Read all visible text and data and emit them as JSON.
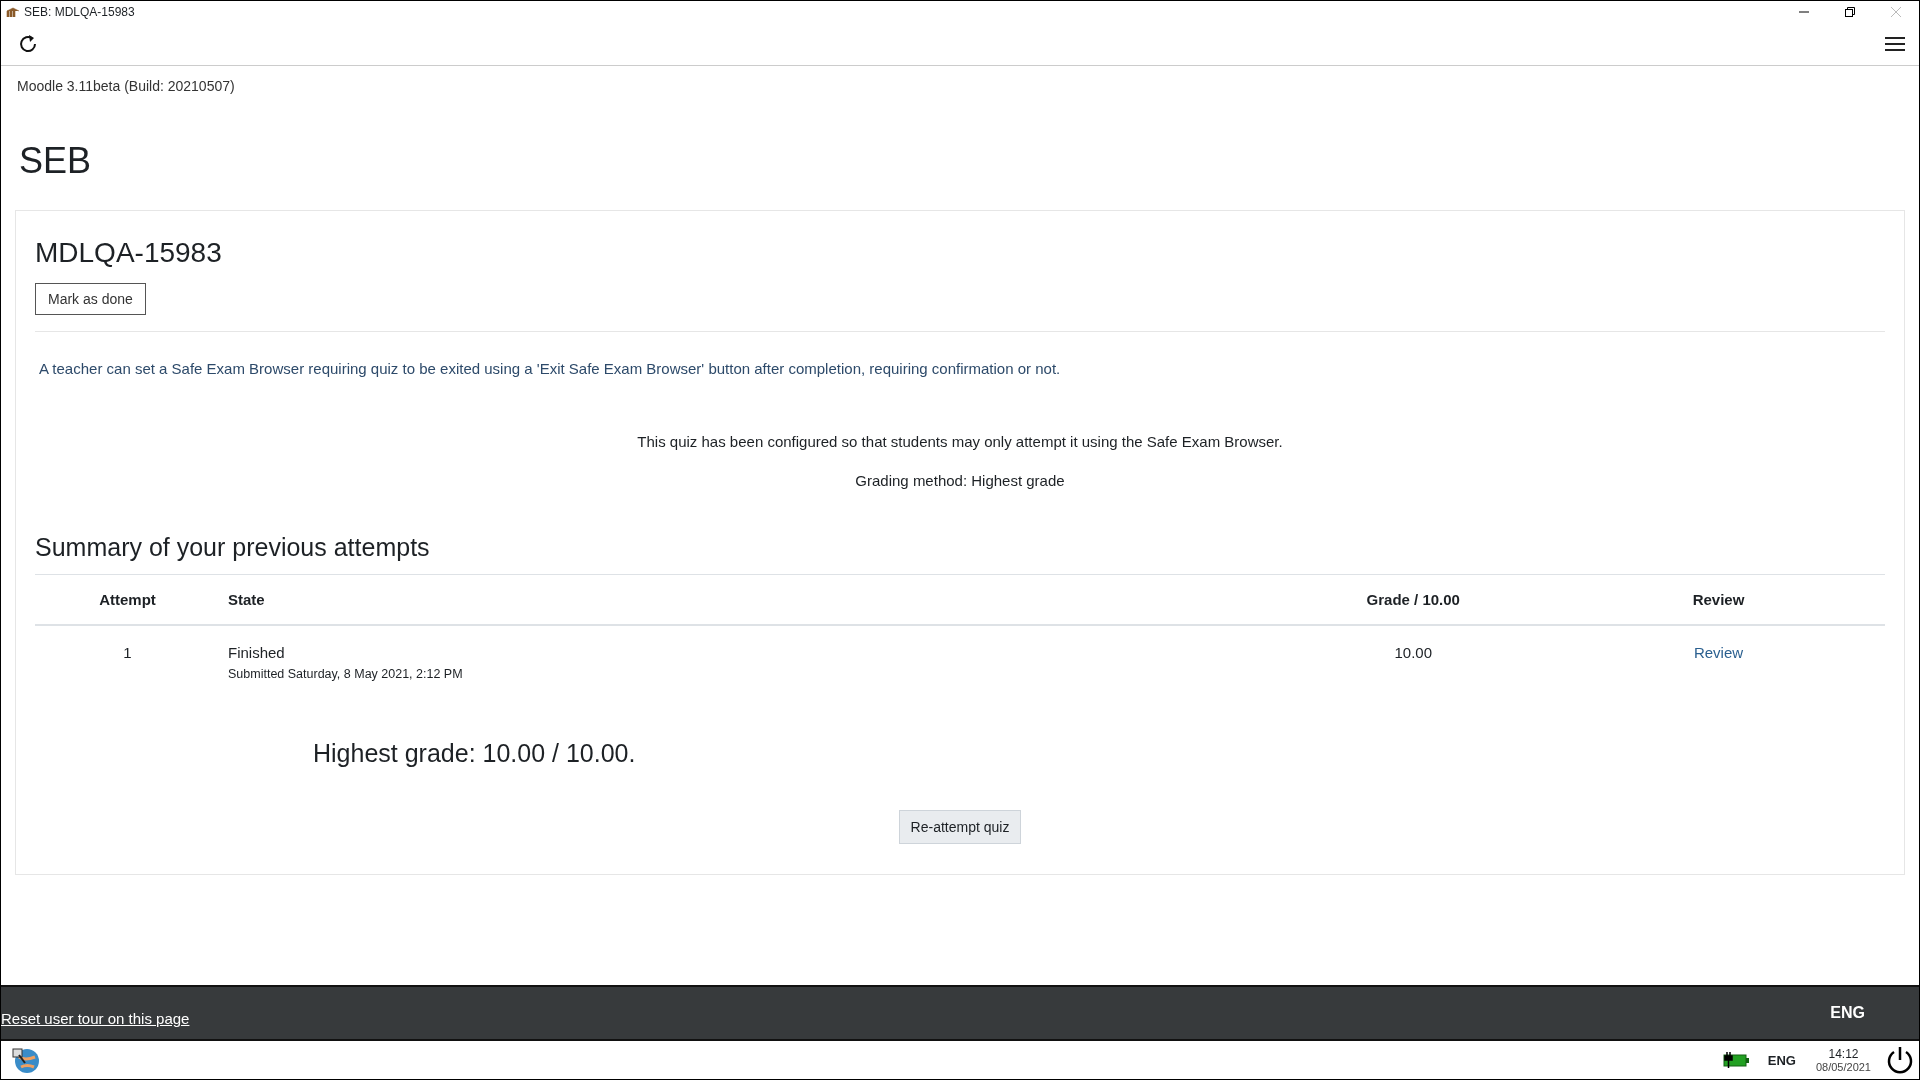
{
  "window": {
    "title": "SEB: MDLQA-15983"
  },
  "version": "Moodle 3.11beta (Build: 20210507)",
  "site_name": "SEB",
  "activity": {
    "title": "MDLQA-15983",
    "completion_button": "Mark as done",
    "description": "A teacher can set a Safe Exam Browser requiring quiz to be exited using a 'Exit Safe Exam Browser' button after completion, requiring confirmation or not.",
    "notices": [
      "This quiz has been configured so that students may only attempt it using the Safe Exam Browser.",
      "Grading method: Highest grade"
    ]
  },
  "attempts": {
    "heading": "Summary of your previous attempts",
    "columns": [
      "Attempt",
      "State",
      "Grade / 10.00",
      "Review"
    ],
    "rows": [
      {
        "attempt": "1",
        "state": "Finished",
        "submitted": "Submitted Saturday, 8 May 2021, 2:12 PM",
        "grade": "10.00",
        "review": "Review"
      }
    ],
    "highest_grade": "Highest grade: 10.00 / 10.00.",
    "reattempt_button": "Re-attempt quiz"
  },
  "footer": {
    "reset_link": "Reset user tour on this page",
    "language": "ENG"
  },
  "taskbar": {
    "language": "ENG",
    "time": "14:12",
    "date": "08/05/2021"
  }
}
